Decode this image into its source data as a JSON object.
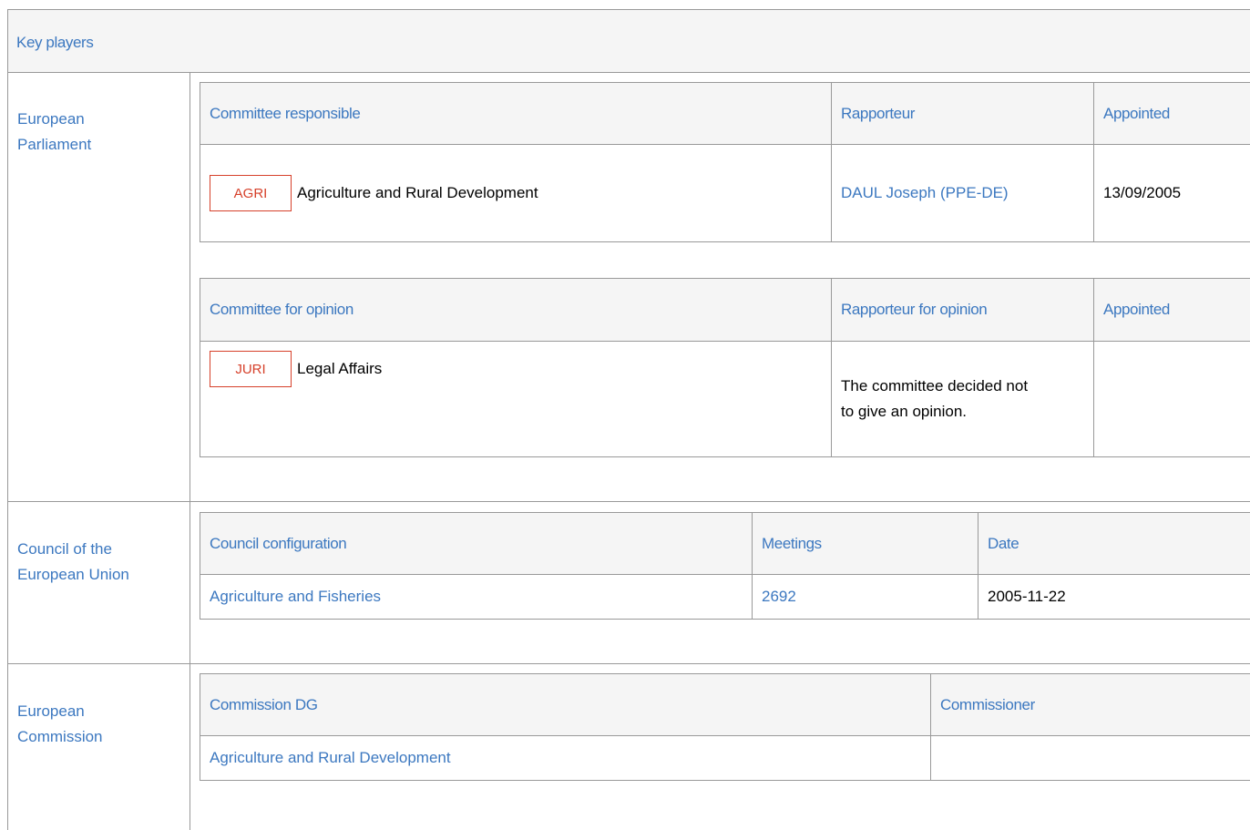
{
  "header": {
    "title": "Key players"
  },
  "parliament": {
    "label": "European Parliament",
    "label_line1": "European",
    "label_line2": "Parliament",
    "responsible": {
      "headers": [
        "Committee responsible",
        "Rapporteur",
        "Appointed"
      ],
      "row": {
        "badge": "AGRI",
        "committee": "Agriculture and Rural Development",
        "rapporteur": "DAUL Joseph (PPE-DE)",
        "appointed": "13/09/2005"
      }
    },
    "opinion": {
      "headers": [
        "Committee for opinion",
        "Rapporteur for opinion",
        "Appointed"
      ],
      "row": {
        "badge": "JURI",
        "committee": "Legal Affairs",
        "rapporteur_line1": "The committee decided not",
        "rapporteur_line2": "to give an opinion.",
        "appointed": ""
      }
    }
  },
  "council": {
    "label_line1": "Council of the",
    "label_line2": "European Union",
    "headers": [
      "Council configuration",
      "Meetings",
      "Date"
    ],
    "row": {
      "configuration": "Agriculture and Fisheries",
      "meetings": "2692",
      "date": "2005-11-22"
    }
  },
  "commission": {
    "label_line1": "European",
    "label_line2": "Commission",
    "headers": [
      "Commission DG",
      "Commissioner"
    ],
    "row": {
      "dg": "Agriculture and Rural Development",
      "commissioner": ""
    }
  },
  "colors": {
    "link": "#3c78c0",
    "badge": "#d6402a",
    "border": "#999999",
    "header_bg": "#f5f5f5"
  }
}
